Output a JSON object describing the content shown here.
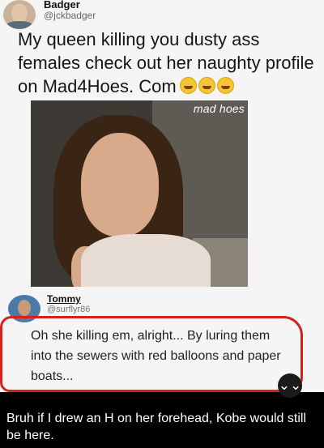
{
  "tweet": {
    "author_name": "Badger",
    "author_handle": "@jckbadger",
    "text": "My queen killing you dusty ass females check out her naughty profile on Mad4Hoes. Com",
    "emoji_names": [
      "rofl-emoji",
      "rofl-emoji",
      "rofl-emoji"
    ],
    "image_watermark": "mad hoes"
  },
  "reply": {
    "author_name": "Tommy",
    "author_handle": "@surflyr86",
    "text": "Oh she killing em, alright... By luring them into the sewers with red balloons and paper boats...",
    "highlight_color": "#d9211b"
  },
  "scroll_button": {
    "glyph": "⌄⌄"
  },
  "caption": {
    "text": "Bruh if I drew an H on her forehead, Kobe would still be here."
  }
}
